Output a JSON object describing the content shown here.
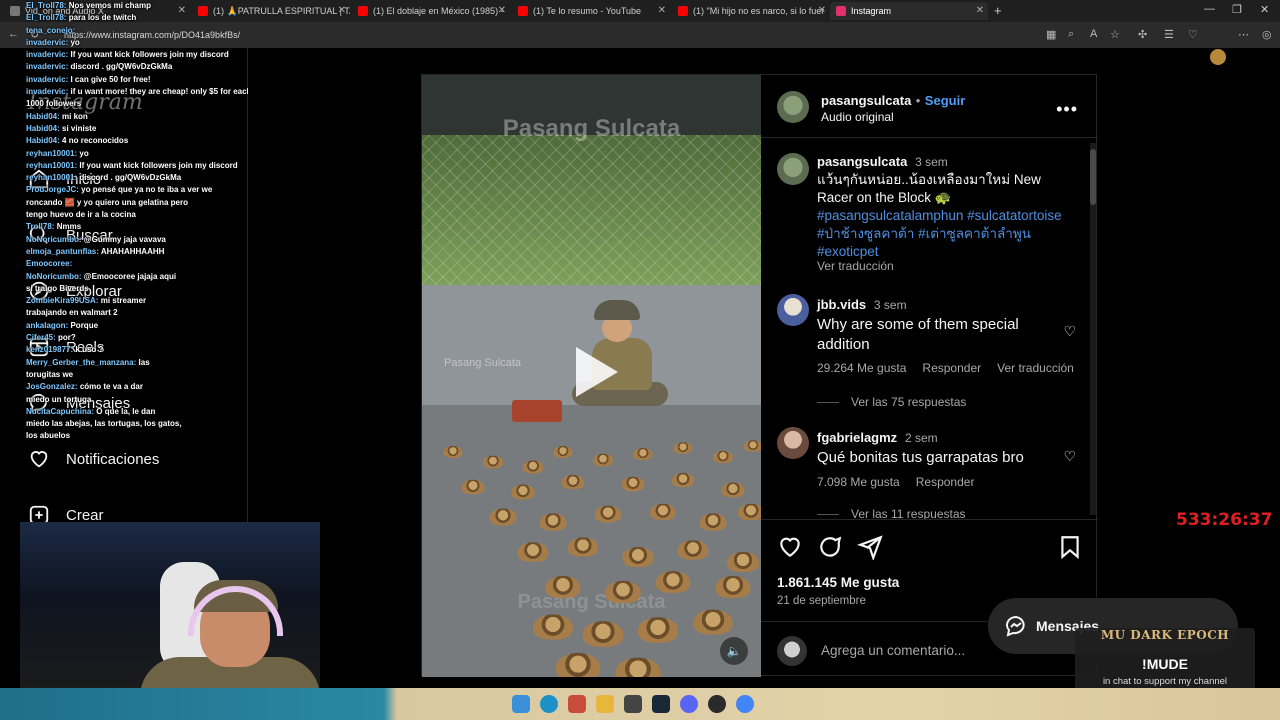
{
  "browser": {
    "tabs": [
      {
        "label": "Vid. on and Audio X",
        "color": "#8a8a8a"
      },
      {
        "label": "(1) 🙏PATRULLA ESPIRITUAL | TA",
        "color": "#ff0000"
      },
      {
        "label": "(1) El doblaje en México (1985) -",
        "color": "#ff0000"
      },
      {
        "label": "(1) Te lo resumo - YouTube",
        "color": "#ff0000"
      },
      {
        "label": "(1) \"Mi hijo no es narco, si lo fuer",
        "color": "#ff0000"
      },
      {
        "label": "Instagram",
        "color": "#e1306c"
      }
    ],
    "url": "https://www.instagram.com/p/DO41a9bkfBs/"
  },
  "sidebar": {
    "logo": "Instagram",
    "items": [
      {
        "label": "Inicio",
        "icon": "home-icon"
      },
      {
        "label": "Buscar",
        "icon": "search-icon"
      },
      {
        "label": "Explorar",
        "icon": "compass-icon"
      },
      {
        "label": "Reels",
        "icon": "reels-icon"
      },
      {
        "label": "Mensajes",
        "icon": "messenger-icon"
      },
      {
        "label": "Notificaciones",
        "icon": "heart-icon"
      },
      {
        "label": "Crear",
        "icon": "plus-square-icon"
      }
    ]
  },
  "chat": [
    {
      "user": "El_Troll78:",
      "text": "Nos vemos mi champ"
    },
    {
      "user": "El_Troll78:",
      "text": "para los de twitch"
    },
    {
      "user": "tena_conejo:",
      "text": ""
    },
    {
      "user": "invadervic:",
      "text": "yo"
    },
    {
      "user": "invadervic:",
      "text": "If you want kick followers join my discord"
    },
    {
      "user": "invadervic:",
      "text": "discord . gg/QW6vDzGkMa"
    },
    {
      "user": "invadervic:",
      "text": "I can give 50 for free!"
    },
    {
      "user": "invadervic:",
      "text": "if u want more! they are cheap! only $5 for each"
    },
    {
      "user": "",
      "text": "1000 followers"
    },
    {
      "user": "Habid04:",
      "text": "mi kon"
    },
    {
      "user": "Habid04:",
      "text": "si viniste"
    },
    {
      "user": "Habid04:",
      "text": "4 no reconocidos"
    },
    {
      "user": "reyhan10001:",
      "text": "yo"
    },
    {
      "user": "reyhan10001:",
      "text": "If you want kick followers join my discord"
    },
    {
      "user": "reyhan10001:",
      "text": "discord . gg/QW6vDzGkMa"
    },
    {
      "user": "ProdJorgeJC:",
      "text": "yo pensé que ya no te iba a ver we"
    },
    {
      "user": "",
      "text": ""
    },
    {
      "user": "",
      "text": "roncando 🧱 y yo quiero una gelatina pero"
    },
    {
      "user": "",
      "text": "tengo huevo de ir a la cocina"
    },
    {
      "user": "Troll78:",
      "text": "Nmms"
    },
    {
      "user": "NoNoricumbo:",
      "text": "@Gummy jaja vavava"
    },
    {
      "user": "elmoja_pantunflas:",
      "text": "AHAHAHHAAHH"
    },
    {
      "user": "Emoocoree:",
      "text": ""
    },
    {
      "user": "NoNoricumbo:",
      "text": "@Emoocoree jajaja aqui"
    },
    {
      "user": "",
      "text": "si traigo Biverds"
    },
    {
      "user": "ZombieKira99USA:",
      "text": "mi streamer"
    },
    {
      "user": "",
      "text": "trabajando en walmart 2"
    },
    {
      "user": "ankalagon:",
      "text": "Porque"
    },
    {
      "user": "Cifer45:",
      "text": "por?"
    },
    {
      "user": "kenz019877:",
      "text": "k uso ?"
    },
    {
      "user": "Merry_Gerber_the_manzana:",
      "text": "las"
    },
    {
      "user": "",
      "text": "torugitas we"
    },
    {
      "user": "JosGonzalez:",
      "text": "cómo te va a dar"
    },
    {
      "user": "",
      "text": "miedo un tortuga"
    },
    {
      "user": "NucitaCapuchina:",
      "text": "O que la, le dan"
    },
    {
      "user": "",
      "text": "miedo las abejas, las tortugas, los gatos,"
    },
    {
      "user": "",
      "text": "los abuelos"
    }
  ],
  "post": {
    "video": {
      "watermark": "Pasang Sulcata",
      "watermark_small": "Pasang Sulcata",
      "watermark_bottom": "Pasang Sulcata"
    },
    "header": {
      "username": "pasangsulcata",
      "separator": "•",
      "follow": "Seguir",
      "audio": "Audio original"
    },
    "caption": {
      "username": "pasangsulcata",
      "time": "3 sem",
      "text": "แว้นๆกันหน่อย..น้องเหลืองมาใหม่ New Racer on the Block 🐢",
      "hashtags": "#pasangsulcatalamphun #sulcatatortoise #ป่าช้างซูลคาต้า #เต่าซูลคาต้าลำพูน #exoticpet",
      "translate": "Ver traducción"
    },
    "comments": [
      {
        "username": "jbb.vids",
        "time": "3 sem",
        "text": "Why are some of them special addition",
        "likes": "29.264 Me gusta",
        "reply": "Responder",
        "translate": "Ver traducción",
        "replies": "Ver las 75 respuestas"
      },
      {
        "username": "fgabrielagmz",
        "time": "2 sem",
        "text": "Qué bonitas tus garrapatas bro",
        "likes": "7.098 Me gusta",
        "reply": "Responder",
        "replies": "Ver las 11 respuestas"
      }
    ],
    "likes": "1.861.145 Me gusta",
    "date": "21 de septiembre",
    "comment_placeholder": "Agrega un comentario..."
  },
  "overlay": {
    "timer": "533:26:37",
    "messages_label": "Mensajes",
    "sponsor_brand": "MU DARK EPOCH",
    "sponsor_cmd": "!MUDE",
    "sponsor_sub": "in chat to support my channel"
  },
  "colors": {
    "accent": "#4f9ef7",
    "hashtag": "#4f8fe0",
    "timer": "#e02020"
  }
}
